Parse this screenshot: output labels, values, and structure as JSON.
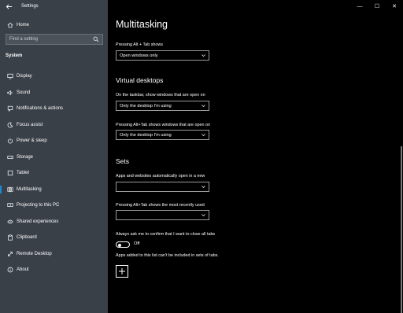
{
  "window": {
    "app_title": "Settings",
    "controls": {
      "minimize": "—",
      "maximize": "☐",
      "close": "✕"
    }
  },
  "sidebar": {
    "home_label": "Home",
    "search_placeholder": "Find a setting",
    "section_title": "System",
    "items": [
      {
        "label": "Display",
        "icon": "display-icon",
        "selected": false
      },
      {
        "label": "Sound",
        "icon": "sound-icon",
        "selected": false
      },
      {
        "label": "Notifications & actions",
        "icon": "notifications-icon",
        "selected": false
      },
      {
        "label": "Focus assist",
        "icon": "focus-assist-icon",
        "selected": false
      },
      {
        "label": "Power & sleep",
        "icon": "power-icon",
        "selected": false
      },
      {
        "label": "Storage",
        "icon": "storage-icon",
        "selected": false
      },
      {
        "label": "Tablet",
        "icon": "tablet-icon",
        "selected": false
      },
      {
        "label": "Multitasking",
        "icon": "multitasking-icon",
        "selected": true
      },
      {
        "label": "Projecting to this PC",
        "icon": "projecting-icon",
        "selected": false
      },
      {
        "label": "Shared experiences",
        "icon": "shared-experiences-icon",
        "selected": false
      },
      {
        "label": "Clipboard",
        "icon": "clipboard-icon",
        "selected": false
      },
      {
        "label": "Remote Desktop",
        "icon": "remote-desktop-icon",
        "selected": false
      },
      {
        "label": "About",
        "icon": "about-icon",
        "selected": false
      }
    ]
  },
  "main": {
    "page_title": "Multitasking",
    "alt_tab_label": "Pressing Alt + Tab shows",
    "alt_tab_value": "Open windows only",
    "virtual_desktops_heading": "Virtual desktops",
    "taskbar_label": "On the taskbar, show windows that are open on",
    "taskbar_value": "Only the desktop I'm using",
    "vd_alt_tab_label": "Pressing Alt+Tab shows windows that are open on",
    "vd_alt_tab_value": "Only the desktop I'm using",
    "sets_heading": "Sets",
    "sets_apps_label": "Apps and websites automatically open in a new",
    "sets_apps_value": "",
    "sets_alt_tab_label": "Pressing Alt+Tab shows the most recently used",
    "sets_alt_tab_value": "",
    "confirm_label": "Always ask me to confirm that I want to close all tabs",
    "confirm_toggle_state": "Off",
    "excluded_label": "Apps added to this list can't be included in sets of tabs.",
    "add_button": "+"
  }
}
